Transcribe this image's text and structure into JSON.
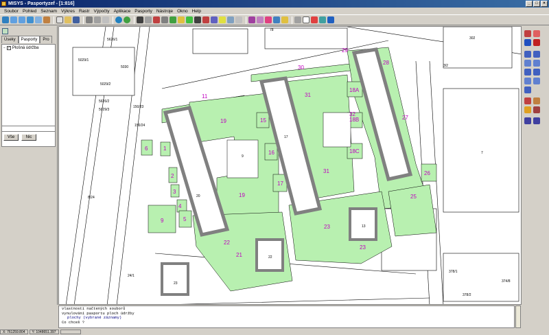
{
  "window": {
    "title": "MISYS - Pasportyzef - [1:816]"
  },
  "menu": [
    "Soubor",
    "Pohled",
    "Seznam",
    "Výkres",
    "Rastr",
    "Výpočty",
    "Aplikace",
    "Pasporty",
    "Nástroje",
    "Okno",
    "Help"
  ],
  "left_panel": {
    "tabs": [
      {
        "label": "Úseky"
      },
      {
        "label": "Pasporty"
      },
      {
        "label": "Pro"
      }
    ],
    "tree_item": "Plošná údržba",
    "buttons": {
      "all": "Vše",
      "none": "Nic"
    }
  },
  "map": {
    "plots": [
      "6",
      "1",
      "2",
      "3",
      "4",
      "5",
      "9",
      "11",
      "19",
      "19",
      "15",
      "16",
      "17",
      "22",
      "21",
      "30",
      "31",
      "31",
      "32",
      "23",
      "23",
      "29",
      "28",
      "18A",
      "18B",
      "18C",
      "27",
      "26",
      "25"
    ],
    "parcels": [
      "9",
      "17",
      "20",
      "22",
      "13",
      "23",
      "7",
      "378/1",
      "378/2",
      "374/8",
      "24/1",
      "78",
      "3/2",
      "302",
      "5626/1",
      "5626/2",
      "5029/1",
      "5029/2",
      "5029/3",
      "5030",
      "150/23",
      "150/24",
      "8/24"
    ]
  },
  "command": {
    "lines": [
      "vlastnosti načtených souborů",
      "vynulování pasportu ploch údržby",
      "plochy (vybrané záznamy)",
      "Co chceš ?"
    ]
  },
  "status": {
    "x": "X: 761259.804",
    "y": "Y: 1048651.397",
    "z": ""
  }
}
